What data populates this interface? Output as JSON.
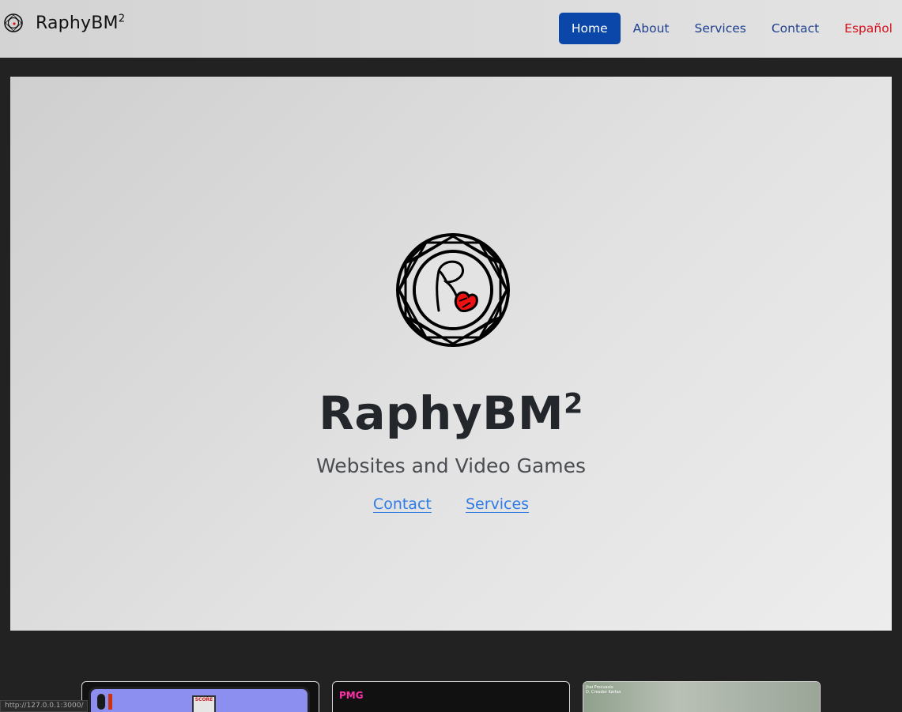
{
  "nav": {
    "brand": "RaphyBM",
    "brand_sup": "2",
    "links": [
      {
        "label": "Home",
        "active": true
      },
      {
        "label": "About",
        "active": false
      },
      {
        "label": "Services",
        "active": false
      },
      {
        "label": "Contact",
        "active": false
      },
      {
        "label": "Español",
        "active": false
      }
    ]
  },
  "hero": {
    "title": "RaphyBM",
    "title_sup": "2",
    "subtitle": "Websites and Video Games",
    "links": [
      "Contact",
      "Services"
    ]
  },
  "cards": {
    "card1_score_label": "SCORE",
    "card2_logo_text": "PMG",
    "card3_text_1": "Jhai Procuasio",
    "card3_text_2": "D. Creador Kartas"
  },
  "status_bar": {
    "url": "http://127.0.0.1:3000/"
  },
  "colors": {
    "nav_active_bg": "#0a47a8",
    "nav_link": "#1f3f8f",
    "lang_link": "#d6101a",
    "hero_link": "#2f7ce8",
    "page_bg": "#222222"
  }
}
